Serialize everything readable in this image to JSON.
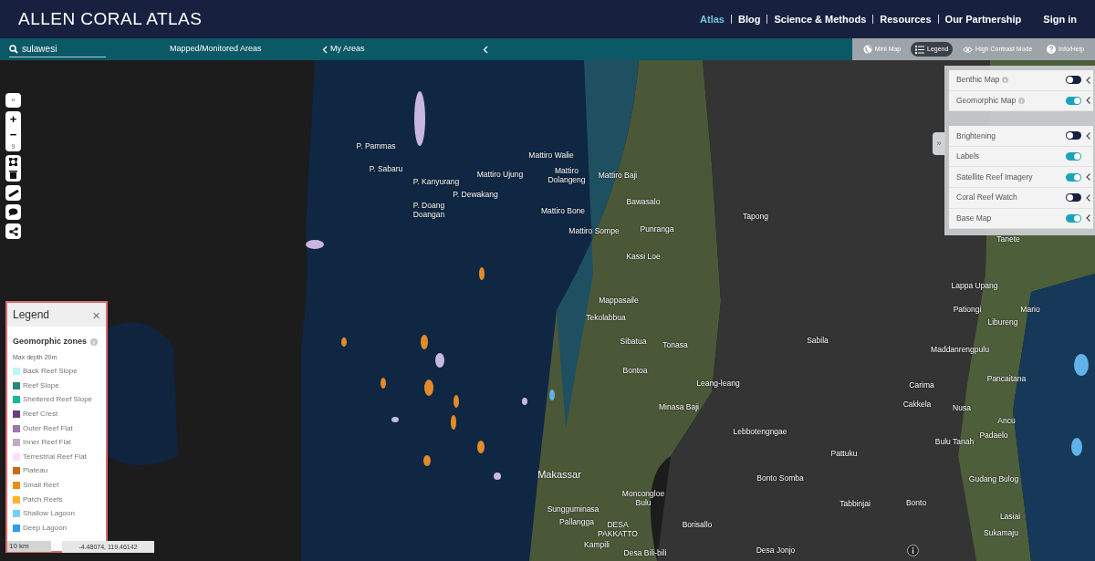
{
  "header": {
    "logo": "ALLEN **CORAL ATLAS**",
    "nav": [
      {
        "label": "Atlas",
        "selected": true
      },
      {
        "label": "Blog",
        "selected": false
      },
      {
        "label": "Science & Methods",
        "selected": false
      },
      {
        "label": "Resources",
        "selected": false
      },
      {
        "label": "Our Partnership",
        "selected": false
      }
    ],
    "sign_in": "Sign in"
  },
  "toolbar": {
    "search": {
      "value": "sulawesi"
    },
    "panels": [
      {
        "label": "Mapped/Monitored Areas"
      },
      {
        "label": "My Areas"
      }
    ],
    "buttons": [
      {
        "kind": "globe",
        "label": "Mini Map",
        "selected": false
      },
      {
        "kind": "list",
        "label": "Legend",
        "selected": true
      },
      {
        "kind": "eye",
        "label": "High Contrast Mode",
        "selected": false
      },
      {
        "kind": "help",
        "label": "Info/Help",
        "selected": false
      }
    ]
  },
  "map_controls": {
    "collapse": "«",
    "zoom_in": "+",
    "zoom_out": "−",
    "zoom_level": "9"
  },
  "legend": {
    "title": "Legend",
    "close": "×",
    "section": "Geomorphic zones",
    "note": "Max depth 20m",
    "items": [
      {
        "label": "Back Reef Slope",
        "color": "#bef6f6"
      },
      {
        "label": "Reef Slope",
        "color": "#2a8873"
      },
      {
        "label": "Sheltered Reef Slope",
        "color": "#19b5a0"
      },
      {
        "label": "Reef Crest",
        "color": "#6a3f7c"
      },
      {
        "label": "Outer Reef Flat",
        "color": "#9b76a8"
      },
      {
        "label": "Inner Reef Flat",
        "color": "#c5a7cd"
      },
      {
        "label": "Terrestrial Reef Flat",
        "color": "#fbdefb"
      },
      {
        "label": "Plateau",
        "color": "#c86a16"
      },
      {
        "label": "Small Reef",
        "color": "#e6901b"
      },
      {
        "label": "Patch Reefs",
        "color": "#fdb42a"
      },
      {
        "label": "Shallow Lagoon",
        "color": "#77d0fc"
      },
      {
        "label": "Deep Lagoon",
        "color": "#2c9bf0"
      }
    ]
  },
  "layers": {
    "expand": "»",
    "groups": [
      {
        "items": [
          {
            "label": "Benthic Map",
            "info": true,
            "on": false,
            "chevron": true
          },
          {
            "label": "Geomorphic Map",
            "info": true,
            "on": true,
            "chevron": true
          }
        ]
      },
      {
        "items": [
          {
            "label": "Brightening",
            "info": false,
            "on": false,
            "chevron": true
          },
          {
            "label": "Labels",
            "info": false,
            "on": true,
            "chevron": false
          },
          {
            "label": "Satellite Reef Imagery",
            "info": false,
            "on": true,
            "chevron": true
          },
          {
            "label": "Coral Reef Watch",
            "info": false,
            "on": false,
            "chevron": true
          },
          {
            "label": "Base Map",
            "info": false,
            "on": true,
            "chevron": true
          }
        ]
      }
    ]
  },
  "scale": "10 km",
  "coordinates": "-4.48074, 119.46142",
  "map_labels": [
    "P. Pammas",
    "P. Sabaru",
    "P. Kanyurang",
    "P. Dewakang",
    "P. Doang Doangan",
    "Mattiro Walie",
    "Mattiro Ujung",
    "Mattiro Dolangeng",
    "Mattiro Baji",
    "Bawasalo",
    "Mattiro Bone",
    "Punranga",
    "Mattiro Sompe",
    "Tapong",
    "Kassi Loe",
    "Mappasaile",
    "Tekolabbua",
    "Sibatua",
    "Tonasa",
    "Bontoa",
    "Leang-leang",
    "Minasa Baji",
    "Lebbotengngae",
    "Makassar",
    "Moncongloe Bulu",
    "Sungguminasa",
    "Pallangga",
    "DESA PAKKATTO",
    "Kampili",
    "Desa Bili-bili",
    "Borisallo",
    "Bonto Somba",
    "Desa Jonjo",
    "Pattuku",
    "Tabbinjai",
    "Bonto",
    "Sabila",
    "Tanete",
    "Lappa Upang",
    "Pationgi",
    "Mario",
    "Libureng",
    "Maddanrengpulu",
    "Pancaitana",
    "Carima",
    "Cakkela",
    "Nusa",
    "Ancu",
    "Padaelo",
    "Bulu Tanah",
    "Gudang Bulog",
    "Lasiai",
    "Sukamaju"
  ]
}
